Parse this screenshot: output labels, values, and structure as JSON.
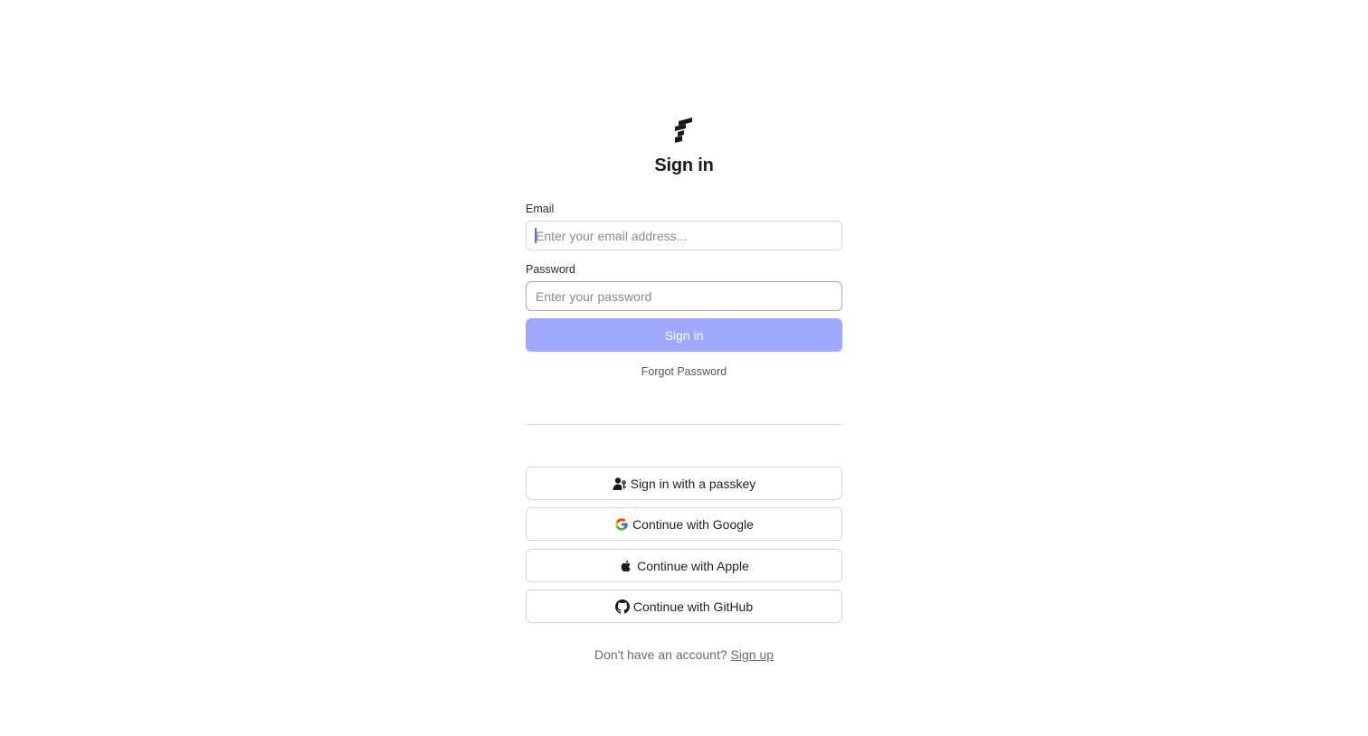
{
  "page": {
    "title": "Sign in"
  },
  "form": {
    "email_label": "Email",
    "email_placeholder": "Enter your email address...",
    "email_value": "",
    "password_label": "Password",
    "password_placeholder": "Enter your password",
    "password_value": "",
    "submit_label": "Sign in",
    "forgot_label": "Forgot Password"
  },
  "social": {
    "passkey": {
      "label": "Sign in with a passkey",
      "icon": "user-key-icon"
    },
    "google": {
      "label": "Continue with Google",
      "icon": "google-icon"
    },
    "apple": {
      "label": "Continue with Apple",
      "icon": "apple-icon"
    },
    "github": {
      "label": "Continue with GitHub",
      "icon": "github-icon"
    }
  },
  "footer": {
    "prompt": "Don't have an account?",
    "signup_label": "Sign up"
  },
  "colors": {
    "primary_button": "#9fa8fd",
    "text": "#1f1f1f",
    "muted_text": "#6a6a6f",
    "border": "#d6d6d9"
  }
}
